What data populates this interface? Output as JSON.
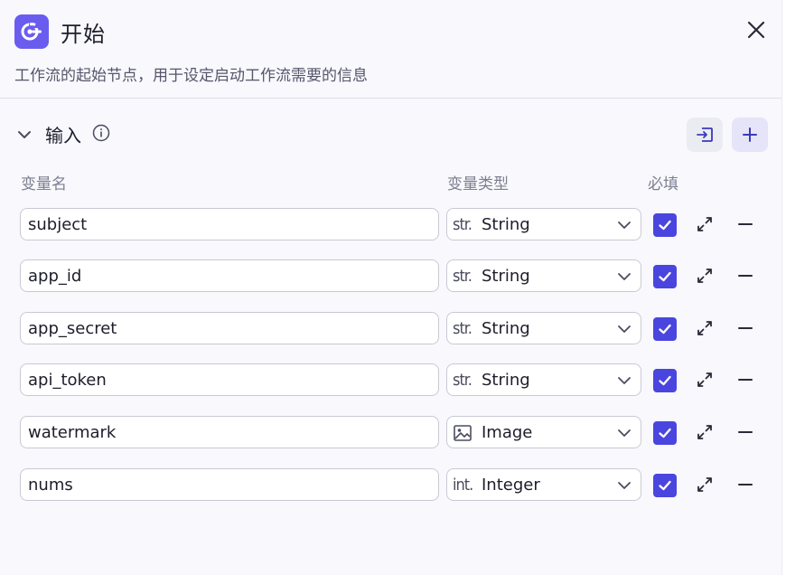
{
  "header": {
    "title": "开始",
    "description": "工作流的起始节点，用于设定启动工作流需要的信息",
    "icon": "start-node-icon",
    "close_icon": "close-icon"
  },
  "inputs_section": {
    "title": "输入",
    "import_icon": "import-icon",
    "add_icon": "plus-icon",
    "columns": {
      "name": "变量名",
      "type": "变量类型",
      "required": "必填"
    }
  },
  "variables": [
    {
      "name": "subject",
      "type_prefix": "str.",
      "type": "String",
      "required": true
    },
    {
      "name": "app_id",
      "type_prefix": "str.",
      "type": "String",
      "required": true
    },
    {
      "name": "app_secret",
      "type_prefix": "str.",
      "type": "String",
      "required": true
    },
    {
      "name": "api_token",
      "type_prefix": "str.",
      "type": "String",
      "required": true
    },
    {
      "name": "watermark",
      "type_prefix": "",
      "type": "Image",
      "required": true
    },
    {
      "name": "nums",
      "type_prefix": "int.",
      "type": "Integer",
      "required": true
    }
  ],
  "colors": {
    "accent": "#4a45df",
    "node_icon_bg": "#6b5cf0"
  }
}
